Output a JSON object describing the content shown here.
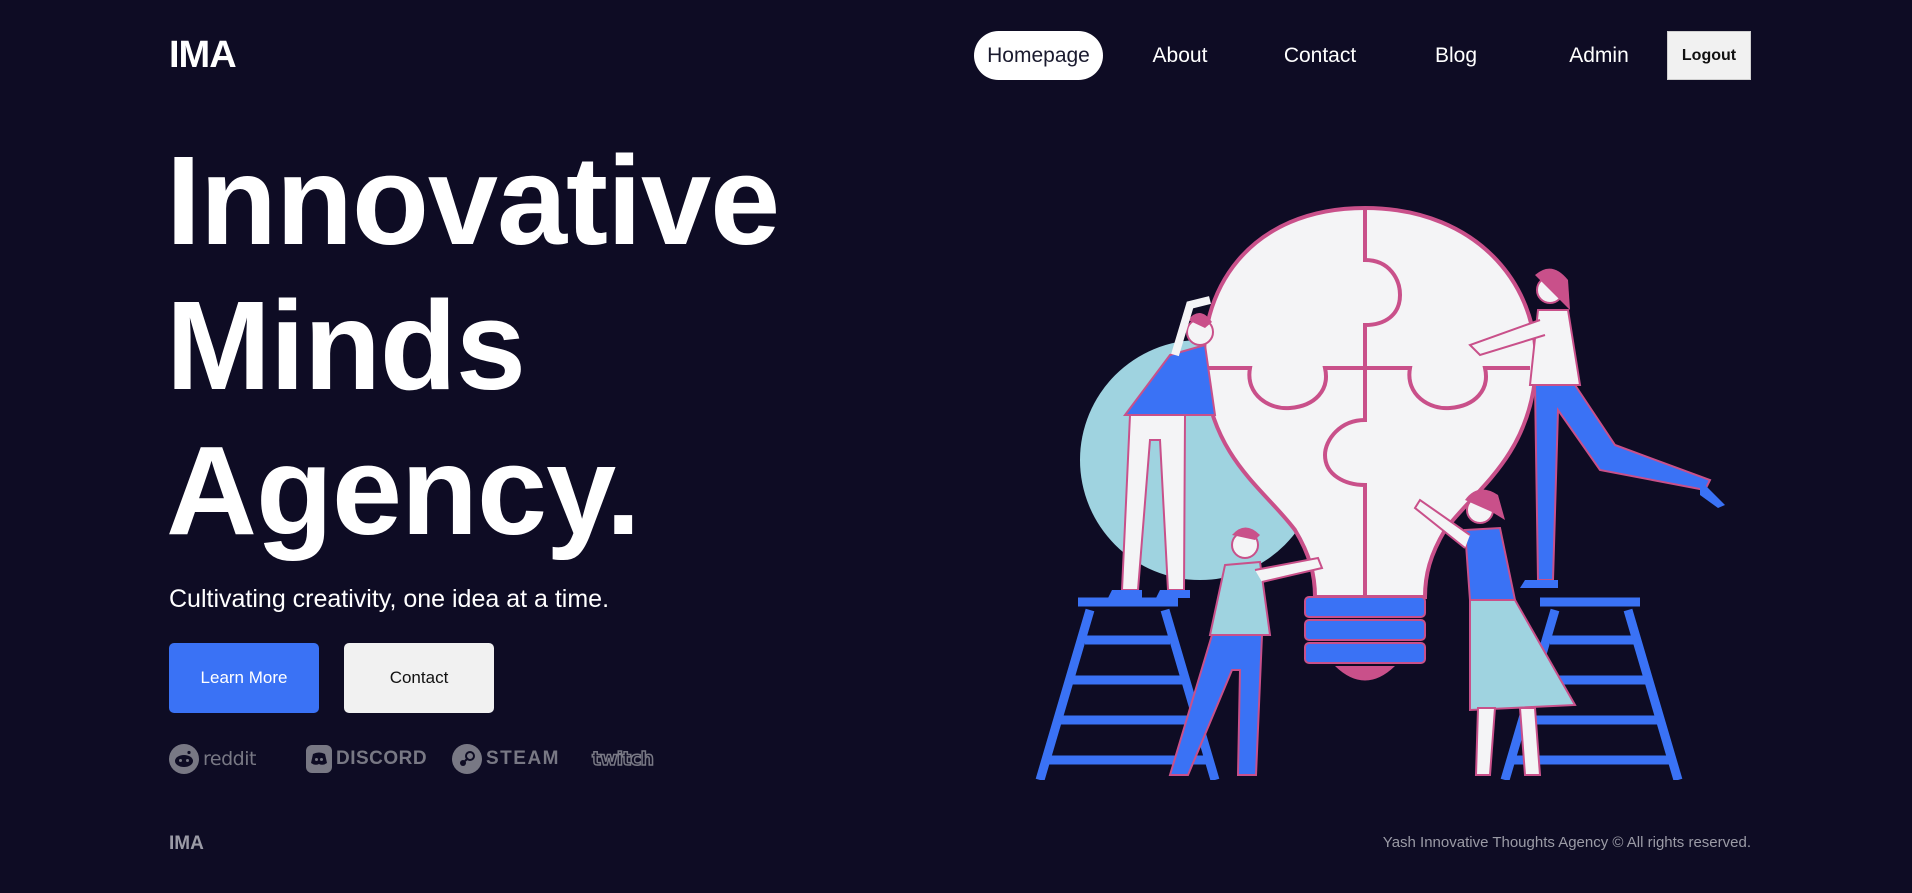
{
  "header": {
    "logo": "IMA",
    "nav": [
      {
        "label": "Homepage",
        "active": true
      },
      {
        "label": "About",
        "active": false
      },
      {
        "label": "Contact",
        "active": false
      },
      {
        "label": "Blog",
        "active": false
      },
      {
        "label": "Admin",
        "active": false
      }
    ],
    "logout_label": "Logout"
  },
  "hero": {
    "title_lines": [
      "Innovative",
      "Minds",
      "Agency."
    ],
    "subtitle": "Cultivating creativity, one idea at a time.",
    "primary_button": "Learn More",
    "secondary_button": "Contact"
  },
  "partners": [
    {
      "name": "reddit",
      "icon": "reddit-icon"
    },
    {
      "name": "DISCORD",
      "icon": "discord-icon"
    },
    {
      "name": "STEAM",
      "icon": "steam-icon"
    },
    {
      "name": "twitch",
      "icon": "twitch-icon"
    }
  ],
  "footer": {
    "logo": "IMA",
    "copyright": "Yash Innovative Thoughts Agency © All rights reserved."
  },
  "colors": {
    "background": "#0e0c24",
    "accent_blue": "#3a72f5",
    "accent_pink": "#c9508a",
    "light_blue": "#9fd3e0"
  }
}
